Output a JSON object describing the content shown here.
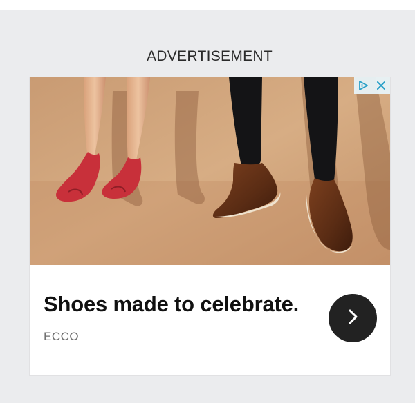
{
  "ad": {
    "label": "ADVERTISEMENT",
    "headline": "Shoes made to celebrate.",
    "advertiser": "ECCO",
    "image_alt": "Ballet flats and brogue shoes",
    "cta_icon": "chevron-right-icon",
    "adchoices_icon": "adchoices-icon",
    "close_icon": "close-icon"
  },
  "colors": {
    "page_background": "#ebecee",
    "card_background": "#ffffff",
    "cta_background": "#222222",
    "adchoices_accent": "#2aa0c8",
    "flats": "#c8303a",
    "brogues": "#6a3418"
  }
}
